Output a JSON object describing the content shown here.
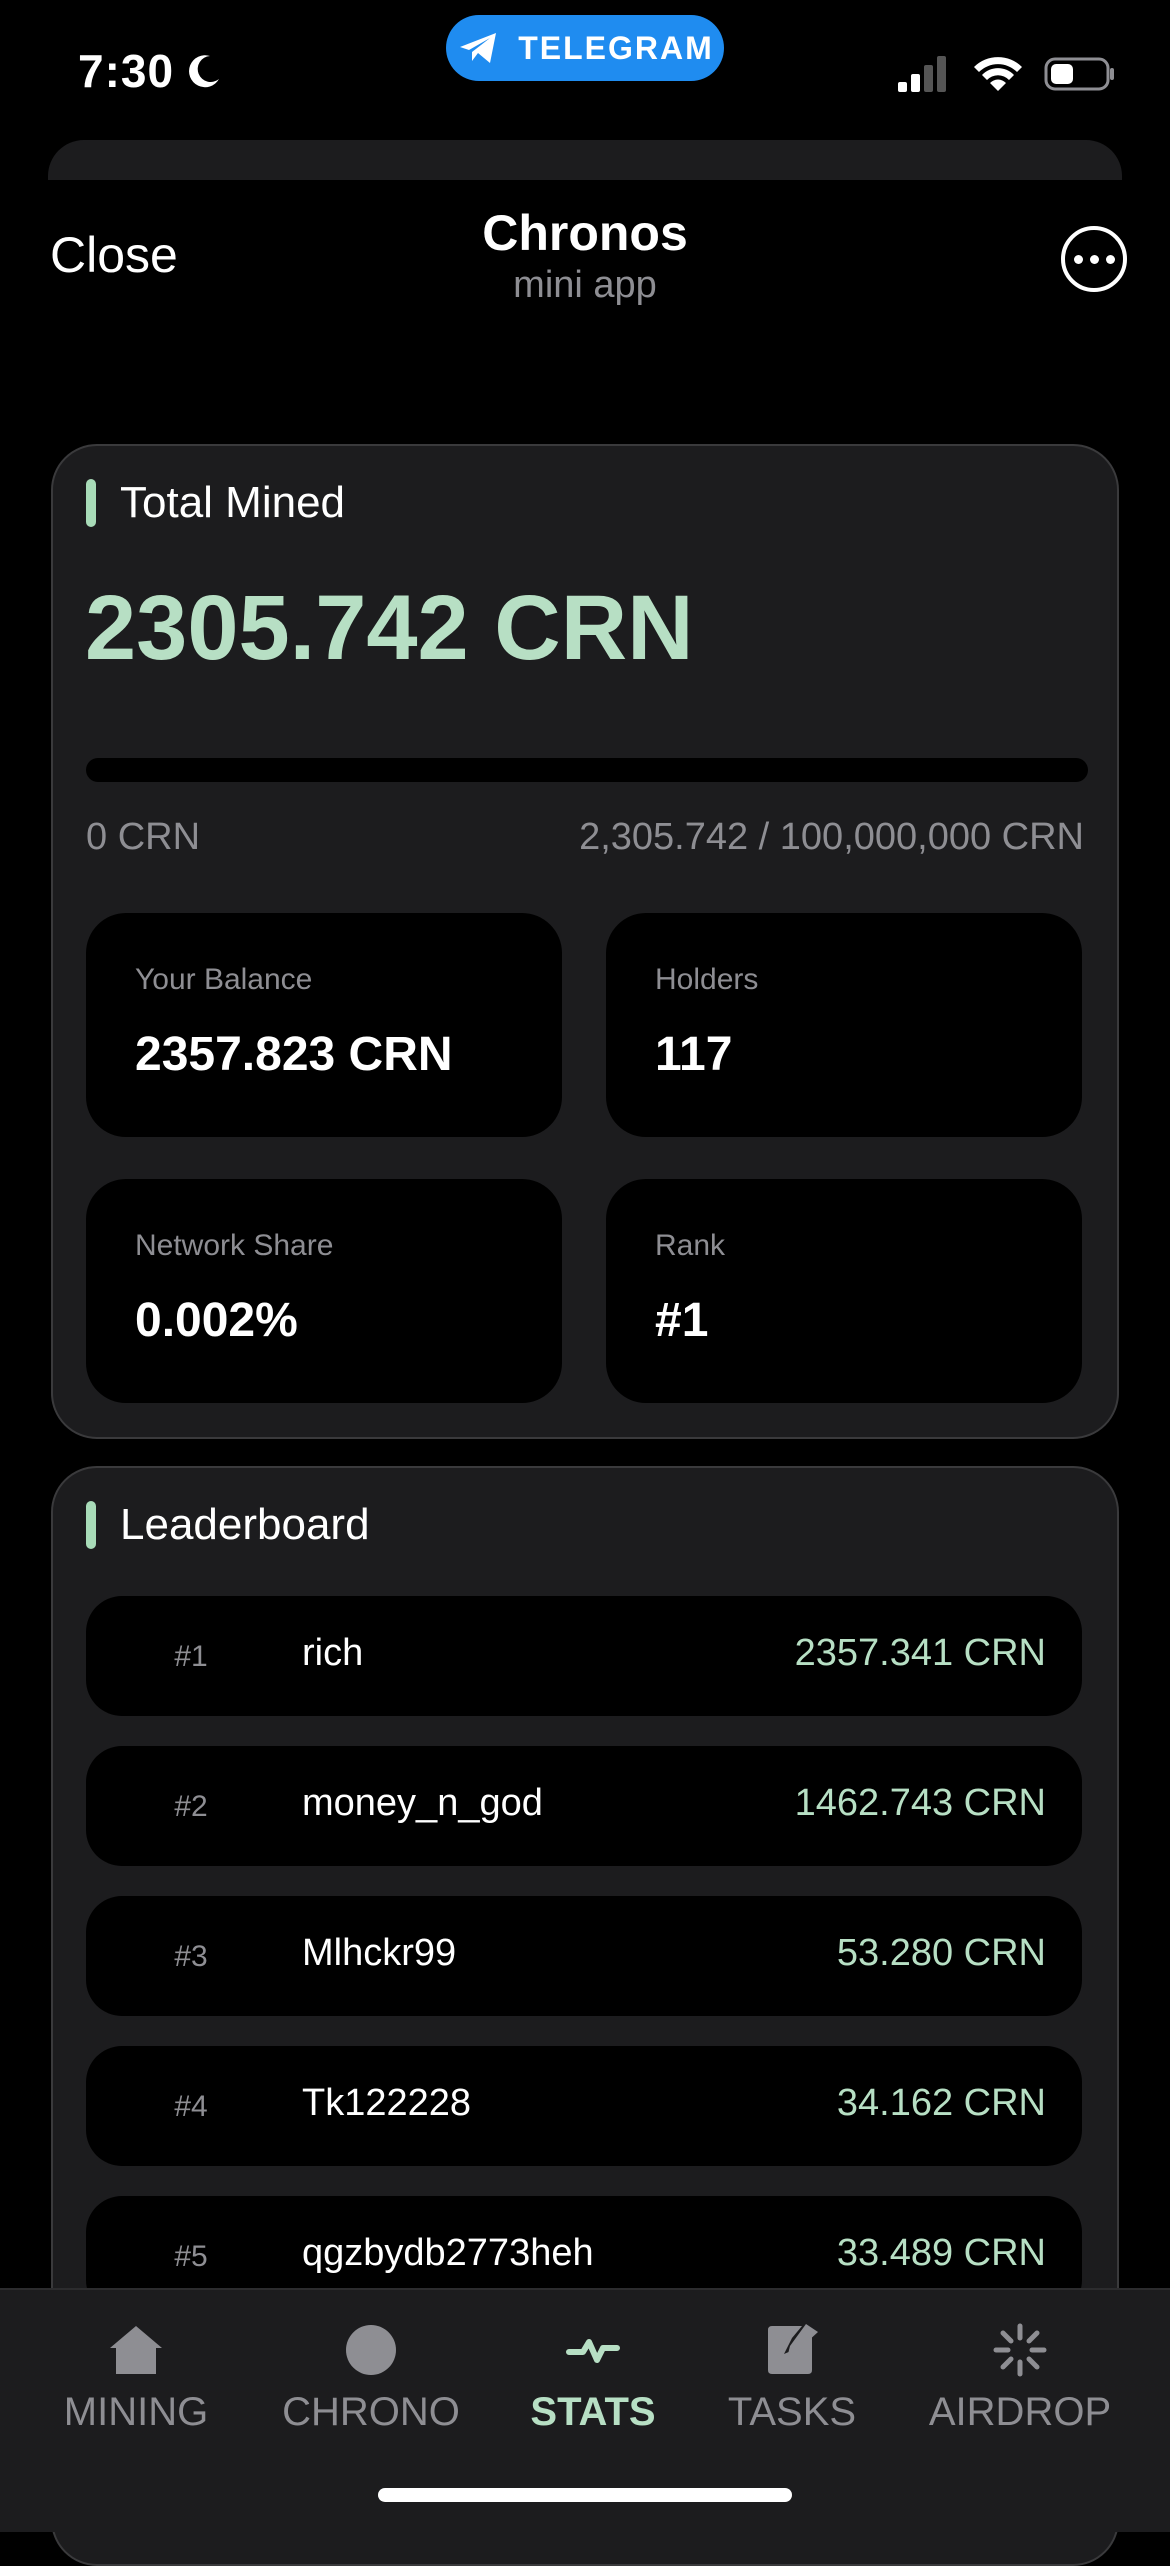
{
  "status_bar": {
    "time": "7:30",
    "telegram_label": "TELEGRAM"
  },
  "header": {
    "close_label": "Close",
    "title": "Chronos",
    "subtitle": "mini app"
  },
  "total_mined": {
    "section_title": "Total Mined",
    "value": "2305.742 CRN",
    "progress_fraction": 2.3e-05,
    "progress_min_label": "0 CRN",
    "progress_max_label": "2,305.742 / 100,000,000 CRN"
  },
  "stats": {
    "balance": {
      "label": "Your Balance",
      "value": "2357.823 CRN"
    },
    "holders": {
      "label": "Holders",
      "value": "117"
    },
    "network_share": {
      "label": "Network Share",
      "value": "0.002%"
    },
    "rank": {
      "label": "Rank",
      "value": "#1"
    }
  },
  "leaderboard": {
    "section_title": "Leaderboard",
    "rows": [
      {
        "rank": "#1",
        "name": "rich",
        "amount": "2357.341 CRN"
      },
      {
        "rank": "#2",
        "name": "money_n_god",
        "amount": "1462.743 CRN"
      },
      {
        "rank": "#3",
        "name": "Mlhckr99",
        "amount": "53.280 CRN"
      },
      {
        "rank": "#4",
        "name": "Tk122228",
        "amount": "34.162 CRN"
      },
      {
        "rank": "#5",
        "name": "qgzbydb2773heh",
        "amount": "33.489 CRN"
      }
    ]
  },
  "nav": {
    "items": [
      {
        "label": "MINING",
        "icon": "home-icon"
      },
      {
        "label": "CHRONO",
        "icon": "circle-icon"
      },
      {
        "label": "STATS",
        "icon": "pulse-icon",
        "active": true
      },
      {
        "label": "TASKS",
        "icon": "edit-icon"
      },
      {
        "label": "AIRDROP",
        "icon": "spinner-icon"
      }
    ]
  },
  "colors": {
    "accent": "#b7dfc4",
    "background": "#000000",
    "card": "#1c1c1e",
    "telegram_blue": "#1f8cf0"
  }
}
